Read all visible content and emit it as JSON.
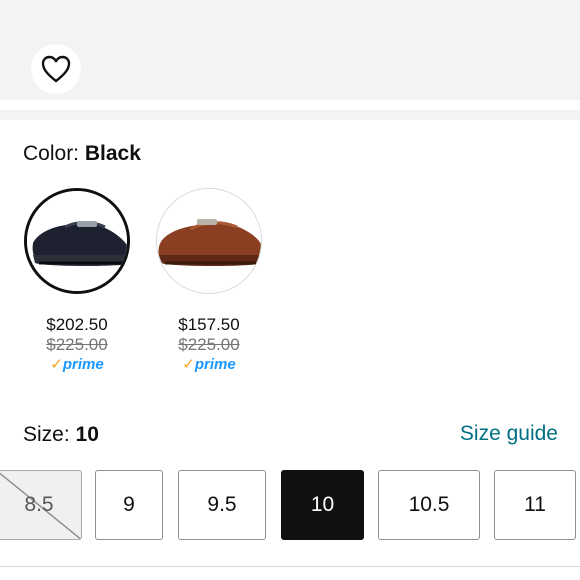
{
  "wishlist": {
    "icon": "heart-icon"
  },
  "color": {
    "label": "Color:",
    "selected_value": "Black",
    "options": [
      {
        "name": "Black",
        "price": "$202.50",
        "list_price": "$225.00",
        "prime_check": "✓",
        "prime_text": "prime",
        "color": "#1e2230"
      },
      {
        "name": "Brown",
        "price": "$157.50",
        "list_price": "$225.00",
        "prime_check": "✓",
        "prime_text": "prime",
        "color": "#8a3f22"
      }
    ]
  },
  "size": {
    "label": "Size:",
    "selected_value": "10",
    "guide_link": "Size guide",
    "options": [
      "8.5",
      "9",
      "9.5",
      "10",
      "10.5",
      "11"
    ]
  },
  "colors": {
    "link": "#007185",
    "prime": "#1a98ff",
    "prime_check": "#f7a21d",
    "selected": "#0f1111"
  }
}
